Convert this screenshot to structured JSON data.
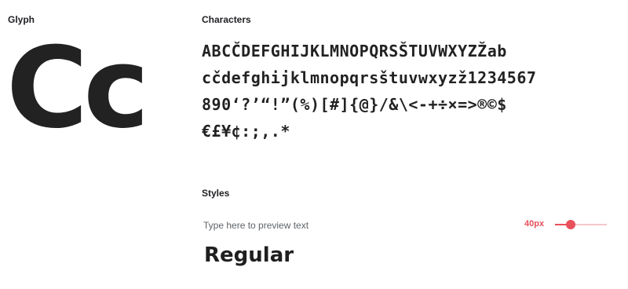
{
  "sections": {
    "glyph": "Glyph",
    "characters": "Characters",
    "styles": "Styles"
  },
  "glyph_preview": "Cc",
  "characters": {
    "lines": [
      "ABCČDEFGHIJKLMNOPQRSŠTUVWXYZŽab",
      "cčdefghijklmnopqrsštuvwxyzž1234567",
      "890‘?’“!”(%)[#]{@}/&\\<-+÷×=>®©$",
      "€£¥¢:;,.*"
    ]
  },
  "preview": {
    "placeholder": "Type here to preview text",
    "size_label": "40px",
    "slider_fraction": 0.3
  },
  "styles": [
    {
      "name": "Regular"
    }
  ],
  "colors": {
    "accent": "#e8505b",
    "text": "#202124"
  }
}
